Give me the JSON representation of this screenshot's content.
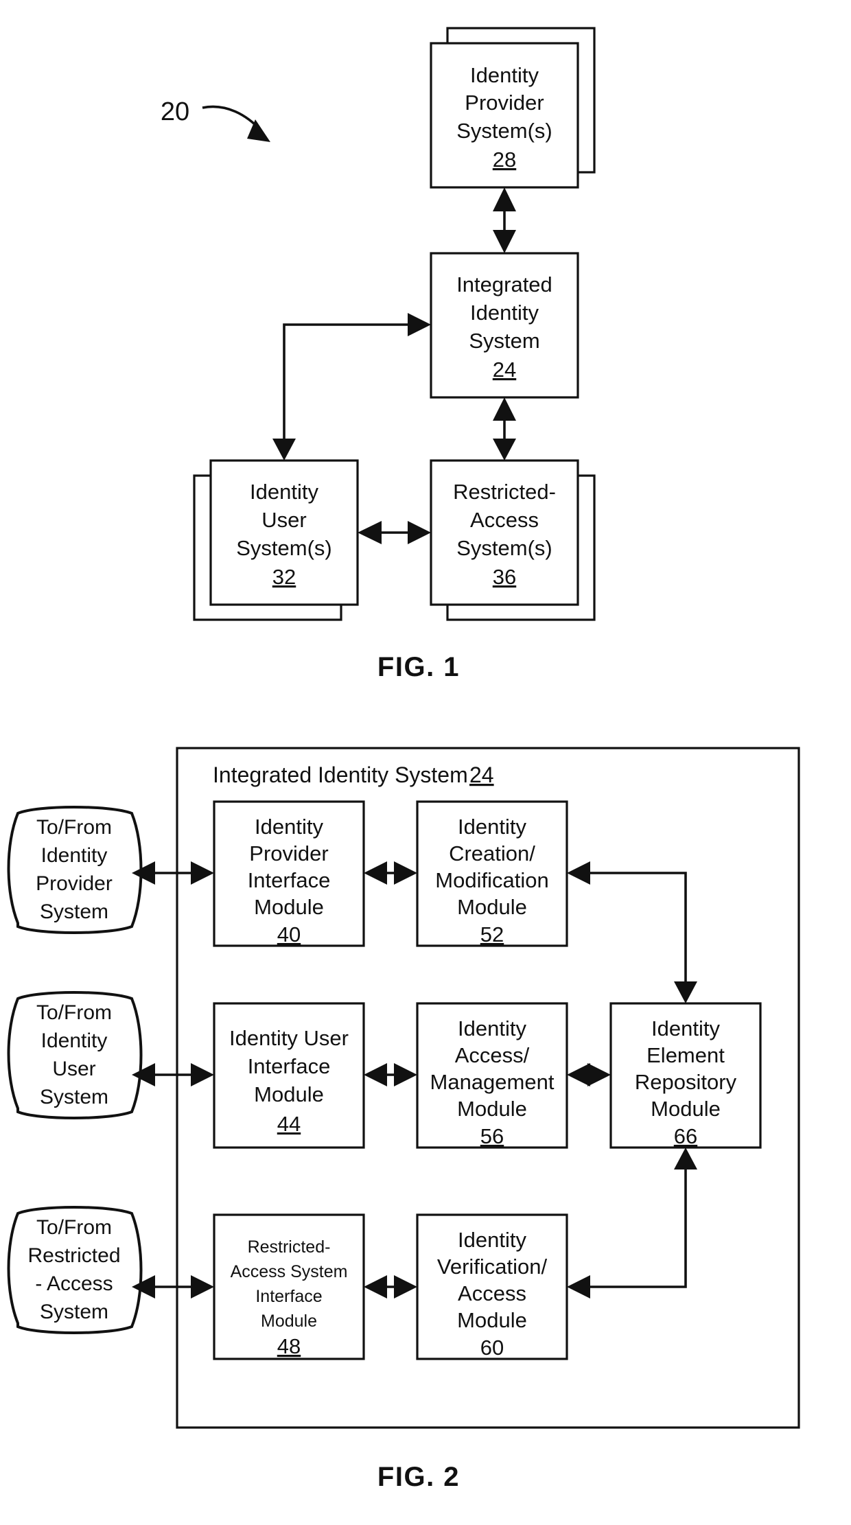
{
  "document": {
    "type": "patent-drawing-sheet",
    "figures": [
      "FIG. 1",
      "FIG. 2"
    ]
  },
  "figure1": {
    "caption": "FIG. 1",
    "reference_numeral": "20",
    "boxes": [
      {
        "id": "identity-provider-system",
        "lines": [
          "Identity",
          "Provider",
          "System(s)"
        ],
        "numeral": "28",
        "numeral_underlined": true,
        "stacked": true,
        "stack_direction": "up-right"
      },
      {
        "id": "integrated-identity-system",
        "lines": [
          "Integrated",
          "Identity",
          "System"
        ],
        "numeral": "24",
        "numeral_underlined": true,
        "stacked": false
      },
      {
        "id": "identity-user-system",
        "lines": [
          "Identity",
          "User",
          "System(s)"
        ],
        "numeral": "32",
        "numeral_underlined": true,
        "stacked": true,
        "stack_direction": "down-left"
      },
      {
        "id": "restricted-access-system",
        "lines": [
          "Restricted-",
          "Access",
          "System(s)"
        ],
        "numeral": "36",
        "numeral_underlined": true,
        "stacked": true,
        "stack_direction": "down-right"
      }
    ],
    "connections": [
      {
        "from": "integrated-identity-system",
        "to": "identity-provider-system",
        "arrow": "both"
      },
      {
        "from": "integrated-identity-system",
        "to": "restricted-access-system",
        "arrow": "both"
      },
      {
        "from": "integrated-identity-system",
        "to": "identity-user-system",
        "arrow": "single"
      },
      {
        "from": "identity-user-system",
        "to": "restricted-access-system",
        "arrow": "both"
      }
    ]
  },
  "figure2": {
    "caption": "FIG. 2",
    "container_title": "Integrated Identity System",
    "container_numeral": "24",
    "external_nodes": [
      {
        "id": "to-from-identity-provider-system",
        "lines": [
          "To/From",
          "Identity",
          "Provider",
          "System"
        ]
      },
      {
        "id": "to-from-identity-user-system",
        "lines": [
          "To/From",
          "Identity",
          "User",
          "System"
        ]
      },
      {
        "id": "to-from-restricted-access-system",
        "lines": [
          "To/From",
          "Restricted",
          "- Access",
          "System"
        ]
      }
    ],
    "modules": [
      {
        "id": "identity-provider-interface-module",
        "lines": [
          "Identity",
          "Provider",
          "Interface",
          "Module"
        ],
        "numeral": "40",
        "numeral_underlined": true,
        "small_text": false
      },
      {
        "id": "identity-creation-modification-module",
        "lines": [
          "Identity",
          "Creation/",
          "Modification",
          "Module"
        ],
        "numeral": "52",
        "numeral_underlined": true,
        "small_text": false
      },
      {
        "id": "identity-user-interface-module",
        "lines": [
          "Identity User",
          "Interface",
          "Module"
        ],
        "numeral": "44",
        "numeral_underlined": true,
        "small_text": false
      },
      {
        "id": "identity-access-management-module",
        "lines": [
          "Identity",
          "Access/",
          "Management",
          "Module"
        ],
        "numeral": "56",
        "numeral_underlined": true,
        "small_text": false
      },
      {
        "id": "identity-element-repository-module",
        "lines": [
          "Identity",
          "Element",
          "Repository",
          "Module"
        ],
        "numeral": "66",
        "numeral_underlined": true,
        "small_text": false
      },
      {
        "id": "restricted-access-system-interface-module",
        "lines": [
          "Restricted-",
          "Access System",
          "Interface",
          "Module"
        ],
        "numeral": "48",
        "numeral_underlined": true,
        "small_text": true
      },
      {
        "id": "identity-verification-access-module",
        "lines": [
          "Identity",
          "Verification/",
          "Access",
          "Module"
        ],
        "numeral": "60",
        "numeral_underlined": false,
        "small_text": false
      }
    ],
    "connections": [
      {
        "from": "to-from-identity-provider-system",
        "to": "identity-provider-interface-module",
        "arrow": "both"
      },
      {
        "from": "identity-provider-interface-module",
        "to": "identity-creation-modification-module",
        "arrow": "both"
      },
      {
        "from": "identity-creation-modification-module",
        "to": "identity-element-repository-module",
        "arrow": "single"
      },
      {
        "from": "to-from-identity-user-system",
        "to": "identity-user-interface-module",
        "arrow": "both"
      },
      {
        "from": "identity-user-interface-module",
        "to": "identity-access-management-module",
        "arrow": "both"
      },
      {
        "from": "identity-access-management-module",
        "to": "identity-element-repository-module",
        "arrow": "both"
      },
      {
        "from": "to-from-restricted-access-system",
        "to": "restricted-access-system-interface-module",
        "arrow": "both"
      },
      {
        "from": "restricted-access-system-interface-module",
        "to": "identity-verification-access-module",
        "arrow": "both"
      },
      {
        "from": "identity-verification-access-module",
        "to": "identity-element-repository-module",
        "arrow": "single"
      }
    ]
  },
  "colors": {
    "ink": "#111111",
    "paper": "#ffffff"
  }
}
